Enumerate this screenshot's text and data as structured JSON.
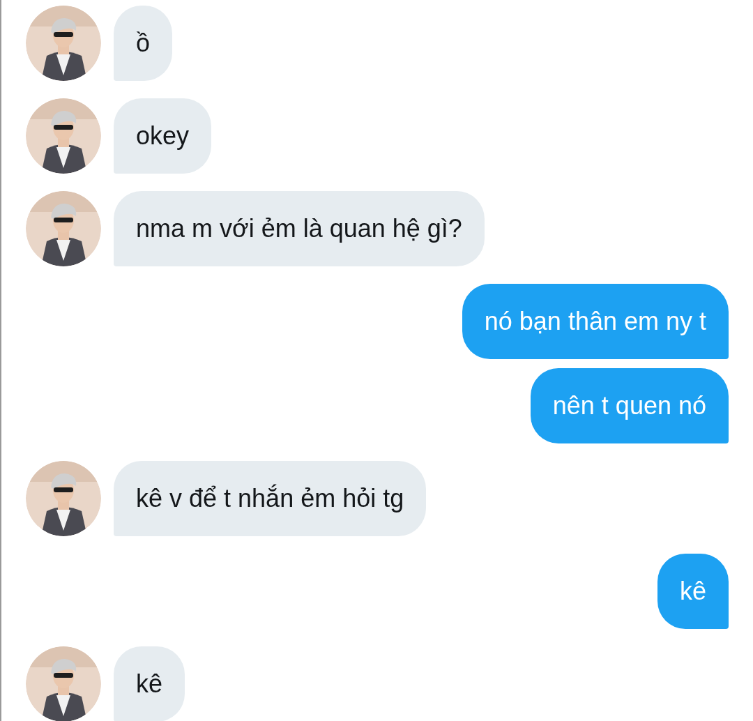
{
  "messages": [
    {
      "kind": "incoming",
      "text": "ồ"
    },
    {
      "kind": "incoming",
      "text": "okey"
    },
    {
      "kind": "incoming",
      "text": "nma m với ẻm là quan hệ gì?"
    },
    {
      "kind": "outgoing",
      "text": "nó bạn thân em ny t"
    },
    {
      "kind": "outgoing",
      "text": "nên t quen nó"
    },
    {
      "kind": "incoming",
      "text": "kê v để t nhắn ẻm hỏi tg"
    },
    {
      "kind": "outgoing",
      "text": "kê"
    },
    {
      "kind": "incoming",
      "text": "kê"
    }
  ]
}
